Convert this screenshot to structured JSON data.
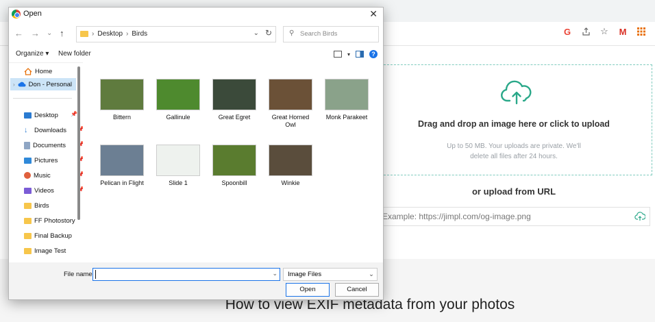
{
  "browser": {
    "extensions": [
      "G",
      "share-icon",
      "☆",
      "M",
      "grid-icon"
    ]
  },
  "upload": {
    "drag_text": "Drag and drop an image here or click to upload",
    "sub_text_1": "Up to 50 MB. Your uploads are private. We'll",
    "sub_text_2": "delete all files after 24 hours.",
    "or_url": "or upload from URL",
    "url_placeholder": "Example: https://jimpl.com/og-image.png"
  },
  "page": {
    "heading": "How to view EXIF metadata from your photos"
  },
  "dialog": {
    "title": "Open",
    "close": "✕",
    "nav": {
      "back": "←",
      "forward": "→",
      "recent": "⌄",
      "up": "↑"
    },
    "breadcrumb": [
      "Desktop",
      "Birds"
    ],
    "search_placeholder": "Search Birds",
    "toolbar": {
      "organize": "Organize ▾",
      "new_folder": "New folder"
    },
    "sidebar": [
      {
        "label": "Home",
        "icon": "home-icon",
        "pin": false
      },
      {
        "label": "Don - Personal",
        "icon": "cloud-icon",
        "pin": false,
        "selected": true
      },
      {
        "label": "Desktop",
        "icon": "desktop-icon",
        "pin": true
      },
      {
        "label": "Downloads",
        "icon": "download-icon",
        "pin": true
      },
      {
        "label": "Documents",
        "icon": "documents-icon",
        "pin": true
      },
      {
        "label": "Pictures",
        "icon": "pictures-icon",
        "pin": true
      },
      {
        "label": "Music",
        "icon": "music-icon",
        "pin": true
      },
      {
        "label": "Videos",
        "icon": "videos-icon",
        "pin": true
      },
      {
        "label": "Birds",
        "icon": "folder-icon",
        "pin": false
      },
      {
        "label": "FF Photostory",
        "icon": "folder-icon",
        "pin": false
      },
      {
        "label": "Final Backup",
        "icon": "folder-icon",
        "pin": false
      },
      {
        "label": "Image Test",
        "icon": "folder-icon",
        "pin": false
      }
    ],
    "files": [
      {
        "name": "Bittern",
        "color": "#5f7b3e"
      },
      {
        "name": "Gallinule",
        "color": "#4e8a2e"
      },
      {
        "name": "Great Egret",
        "color": "#3b4a3a"
      },
      {
        "name": "Great Horned Owl",
        "color": "#6b5137"
      },
      {
        "name": "Monk Parakeet",
        "color": "#8aa28a"
      },
      {
        "name": "Pelican in Flight",
        "color": "#6c7f93"
      },
      {
        "name": "Slide 1",
        "color": "#eef2ee"
      },
      {
        "name": "Spoonbill",
        "color": "#5a7c2f"
      },
      {
        "name": "Winkie",
        "color": "#5a4d3c"
      }
    ],
    "file_name_label": "File name:",
    "file_type": "Image Files",
    "open_button": "Open",
    "cancel_button": "Cancel"
  }
}
